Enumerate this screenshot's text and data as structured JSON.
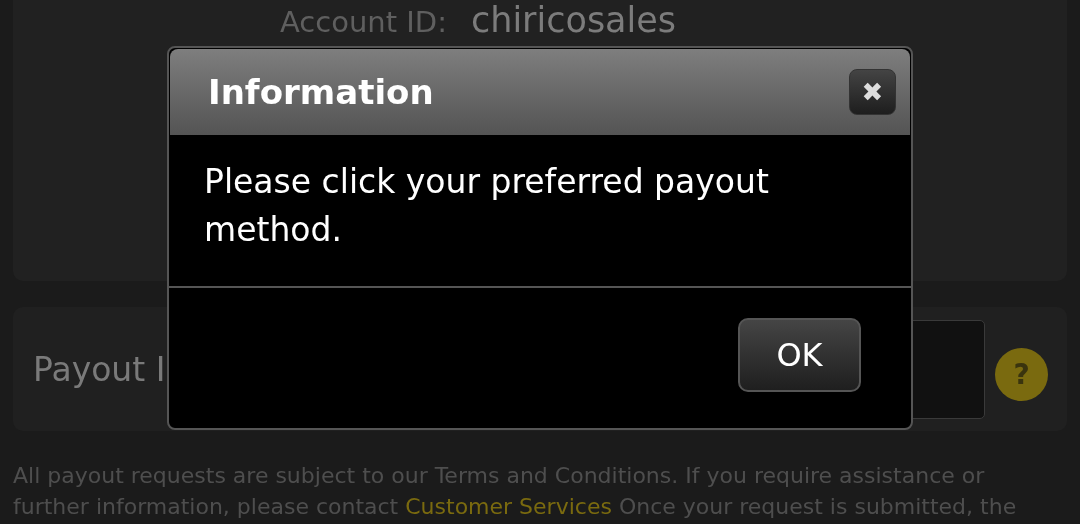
{
  "account": {
    "label": "Account ID:",
    "value": "chiricosales"
  },
  "payout": {
    "label": "Payout I"
  },
  "help": {
    "icon": "?"
  },
  "footer": {
    "lines": [
      "All payout requests are subject to our Terms and Conditions. If you require assistance or",
      "further information, please contact "
    ],
    "link": "Customer Services",
    "after_link": " Once your request is submitted, the"
  },
  "dialog": {
    "title": "Information",
    "close": "✖",
    "message": "Please click your preferred payout method.",
    "button": "OK"
  }
}
